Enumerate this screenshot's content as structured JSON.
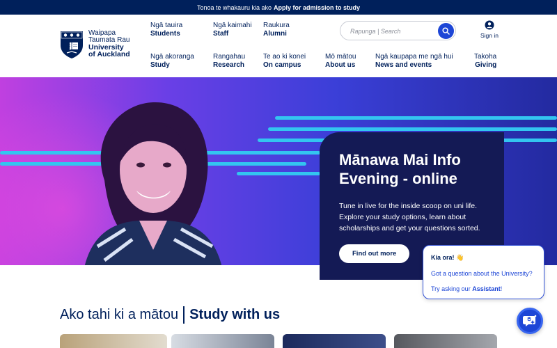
{
  "banner": {
    "prefix": "Tonoa te whakauru kia ako",
    "link": "Apply for admission to study"
  },
  "logo": {
    "line1": "Waipapa",
    "line2": "Taumata Rau",
    "line3": "University",
    "line4": "of Auckland"
  },
  "nav_top": [
    {
      "mi": "Ngā tauira",
      "en": "Students"
    },
    {
      "mi": "Ngā kaimahi",
      "en": "Staff"
    },
    {
      "mi": "Raukura",
      "en": "Alumni"
    }
  ],
  "nav_main": [
    {
      "mi": "Ngā akoranga",
      "en": "Study"
    },
    {
      "mi": "Rangahau",
      "en": "Research"
    },
    {
      "mi": "Te ao ki konei",
      "en": "On campus"
    },
    {
      "mi": "Mō mātou",
      "en": "About us"
    },
    {
      "mi": "Ngā kaupapa me ngā hui",
      "en": "News and events"
    },
    {
      "mi": "Takoha",
      "en": "Giving"
    }
  ],
  "search": {
    "placeholder": "Rapunga | Search",
    "icon": "search-icon"
  },
  "signin": {
    "label": "Sign in",
    "icon": "user-icon"
  },
  "hero": {
    "title": "Mānawa Mai Info Evening - online",
    "body": "Tune in live for the inside scoop on uni life. Explore your study options, learn about scholarships and get your questions sorted.",
    "cta": "Find out more"
  },
  "study": {
    "mi": "Ako tahi ki a mātou",
    "en": "Study with us"
  },
  "chat": {
    "greeting": "Kia ora! 👋",
    "question": "Got a question about the University?",
    "prompt_prefix": "Try asking our",
    "prompt_link": "Assistant",
    "prompt_suffix": "!",
    "icon": "assistant-chat-icon"
  },
  "colors": {
    "navy": "#00205b",
    "accent_blue": "#1d46d6",
    "stripe_cyan": "#33c5f0",
    "card_bg": "#141a55"
  }
}
